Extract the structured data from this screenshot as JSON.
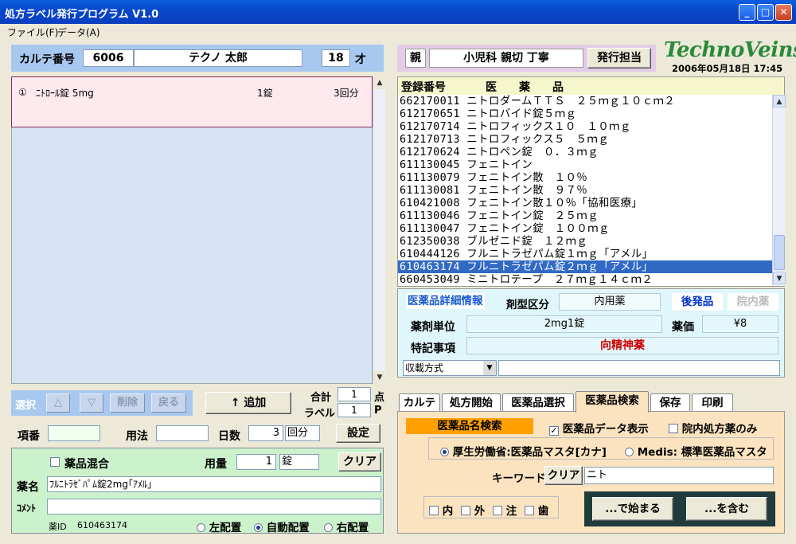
{
  "window": {
    "title": "処方ラベル発行プログラム V1.0"
  },
  "menu": {
    "items": [
      "ファイル(F)",
      "データ(A)"
    ]
  },
  "patient": {
    "karte_label": "カルテ番号",
    "karte_no": "6006",
    "name": "テクノ 太郎",
    "age": "18",
    "age_unit": "才"
  },
  "dept": {
    "label": "親",
    "value": "小児科 親切 丁寧",
    "staff_button": "発行担当"
  },
  "brand": {
    "logo": "TechnoVeins",
    "datetime": "2006年05月18日 17:45"
  },
  "rx_items": [
    {
      "no": "①",
      "drug": "ﾆﾄﾛｰﾙ錠 5mg",
      "qty": "1錠",
      "times": "3回分"
    }
  ],
  "selection": {
    "label": "選択",
    "up": "△",
    "down": "▽",
    "delete": "削除",
    "back": "戻る"
  },
  "add_button": "↑ 追加",
  "totals": {
    "total_label": "合計",
    "total_value": "1",
    "total_unit": "点",
    "label_label": "ラベル",
    "label_value": "1",
    "label_unit": "P"
  },
  "dose": {
    "item_no_label": "項番",
    "item_no": "",
    "usage_label": "用法",
    "usage": "",
    "days_label": "日数",
    "days": "3",
    "days_unit": "回分",
    "set_button": "設定"
  },
  "entry": {
    "mix_label": "薬品混合",
    "amount_label": "用量",
    "amount": "1",
    "unit": "錠",
    "clear_button": "クリア",
    "name_label": "薬名",
    "name_value": "ﾌﾙﾆﾄﾗｾﾞﾊﾟﾑ錠2mg｢ｱﾒﾙ｣",
    "comment_label": "ｺﾒﾝﾄ",
    "comment": "",
    "drug_id_label": "薬ID",
    "drug_id": "610463174",
    "placement": [
      "左配置",
      "自動配置",
      "右配置"
    ]
  },
  "druglist": {
    "header_code": "登録番号",
    "header_name": "医　　薬　　品",
    "rows": [
      {
        "code": "662170011",
        "name": "ニトロダームＴＴＳ　２５ｍｇ１０ｃｍ２"
      },
      {
        "code": "612170651",
        "name": "ニトロバイド錠５ｍｇ"
      },
      {
        "code": "612170714",
        "name": "ニトロフィックス１０　１０ｍｇ"
      },
      {
        "code": "612170713",
        "name": "ニトロフィックス５　５ｍｇ"
      },
      {
        "code": "612170624",
        "name": "ニトロペン錠　０．３ｍｇ"
      },
      {
        "code": "611130045",
        "name": "フェニトイン"
      },
      {
        "code": "611130079",
        "name": "フェニトイン散　１０％"
      },
      {
        "code": "611130081",
        "name": "フェニトイン散　９７％"
      },
      {
        "code": "610421008",
        "name": "フェニトイン散１０％「協和医療」"
      },
      {
        "code": "611130046",
        "name": "フェニトイン錠　２５ｍｇ"
      },
      {
        "code": "611130047",
        "name": "フェニトイン錠　１００ｍｇ"
      },
      {
        "code": "612350038",
        "name": "ブルゼニド錠　１２ｍｇ"
      },
      {
        "code": "610444126",
        "name": "フルニトラゼパム錠１ｍｇ「アメル」"
      },
      {
        "code": "610463174",
        "name": "フルニトラゼパム錠２ｍｇ「アメル」"
      },
      {
        "code": "660453049",
        "name": "ミニトロテープ　２７ｍｇ１４ｃｍ２"
      }
    ],
    "selected_index": 13
  },
  "detail": {
    "title": "医薬品詳細情報",
    "form_label": "剤型区分",
    "form_value": "内用薬",
    "generic": "後発品",
    "inhouse": "院内薬",
    "unit_label": "薬剤単位",
    "unit_value": "2mg1錠",
    "price_label": "薬価",
    "price_value": "¥8",
    "note_label": "特記事項",
    "note_value": "向精神薬",
    "sort_select": "収載方式",
    "sort_text": ""
  },
  "tabs": [
    "カルテ",
    "処方開始",
    "医薬品選択",
    "医薬品検索",
    "保存",
    "印刷"
  ],
  "active_tab": 3,
  "search": {
    "title": "医薬品名検索",
    "show_data": "医薬品データ表示",
    "inhouse_only": "院内処方薬のみ",
    "source_mhlw": "厚生労働省:医薬品マスタ[カナ]",
    "source_medis": "Medis: 標準医薬品マスタ",
    "keyword_label": "キーワード",
    "clear_button": "クリア",
    "keyword": "ニト",
    "filters": [
      "内",
      "外",
      "注",
      "歯"
    ],
    "starts_with": "...で始まる",
    "contains": "...を含む"
  },
  "colors": {
    "titlebar": "#0a4fd8",
    "selected": "#316ac5",
    "note_red": "#cc0000",
    "generic_blue": "#0033cc"
  }
}
